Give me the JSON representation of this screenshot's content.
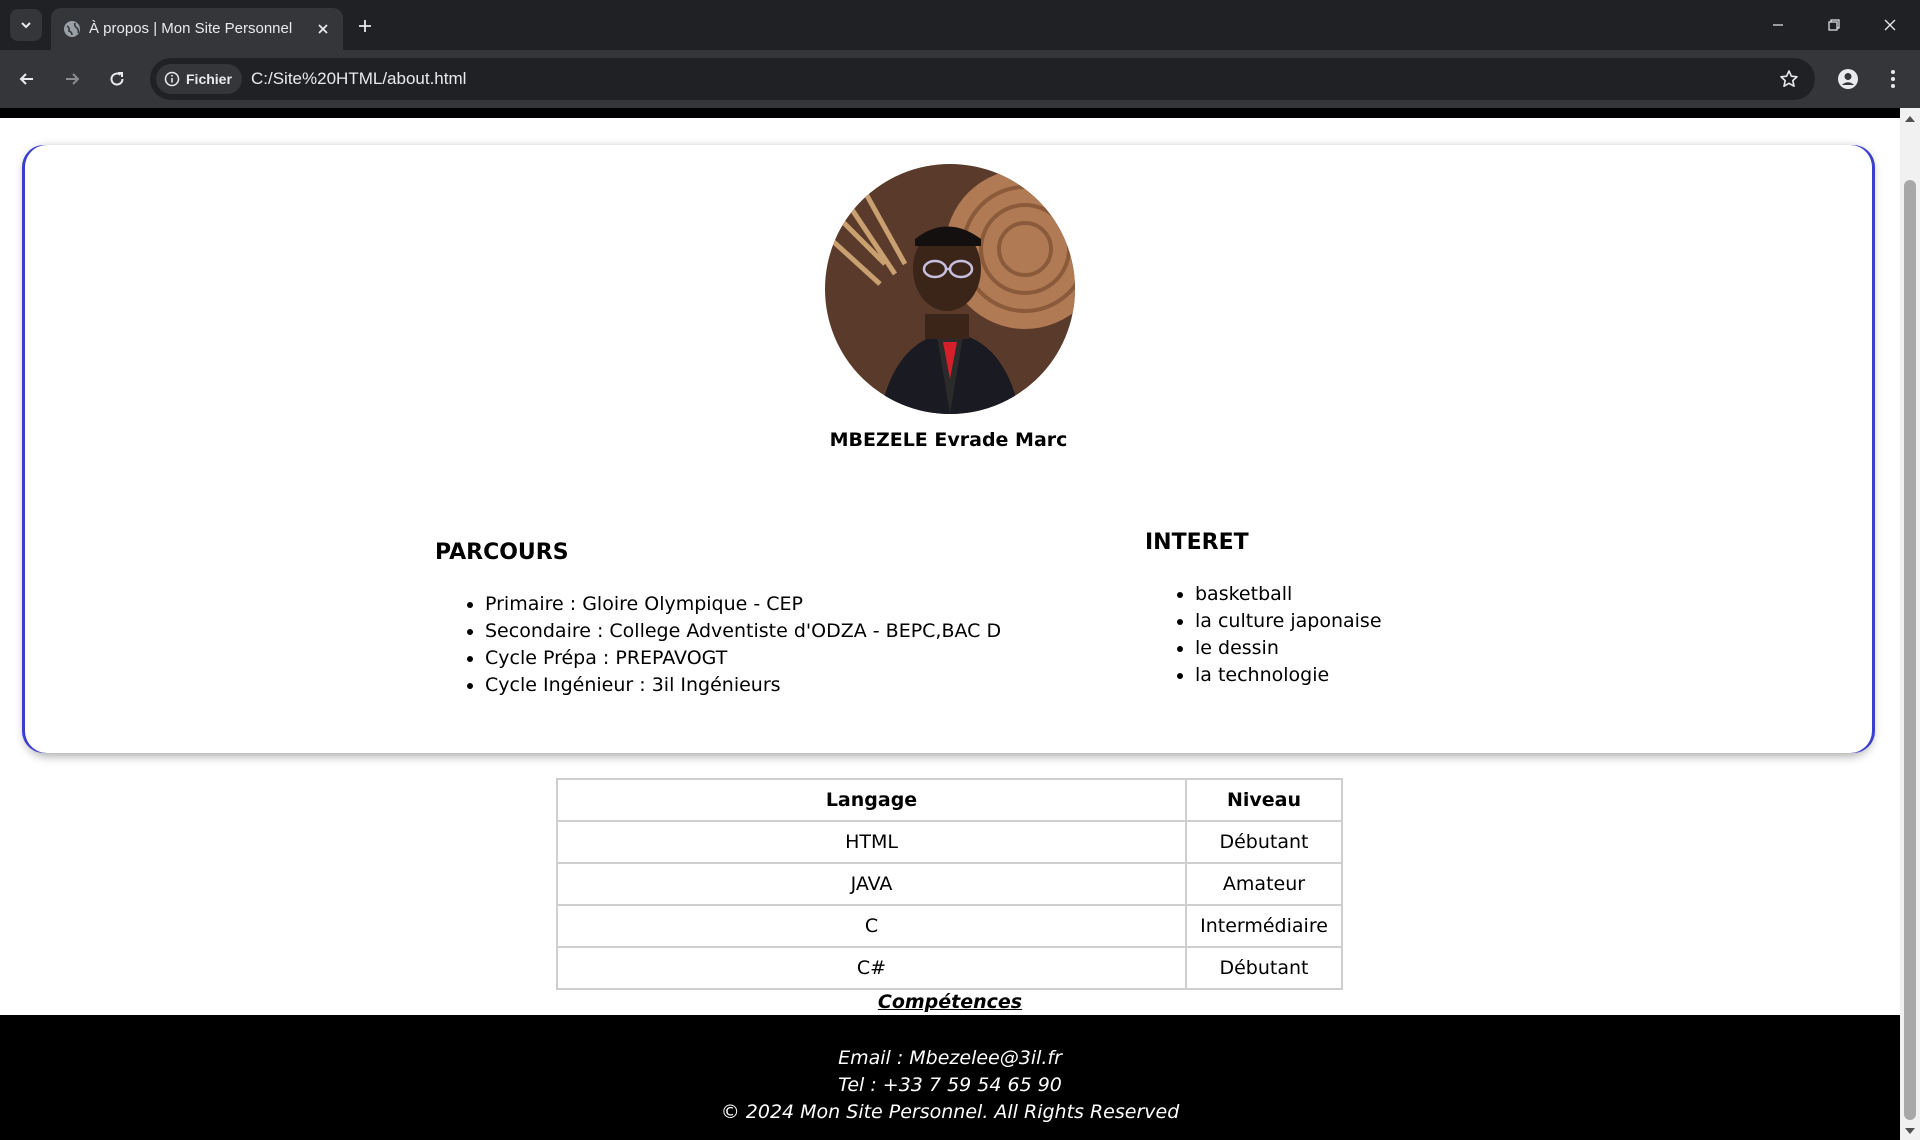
{
  "browser": {
    "tab_title": "À propos | Mon Site Personnel",
    "site_chip": "Fichier",
    "url": "C:/Site%20HTML/about.html"
  },
  "profile": {
    "name": "MBEZELE Evrade Marc"
  },
  "parcours": {
    "title": "PARCOURS",
    "items": [
      "Primaire : Gloire Olympique - CEP",
      "Secondaire : College Adventiste d'ODZA - BEPC,BAC D",
      "Cycle Prépa : PREPAVOGT",
      "Cycle Ingénieur : 3il Ingénieurs"
    ]
  },
  "interet": {
    "title": "INTERET",
    "items": [
      "basketball",
      "la culture japonaise",
      "le dessin",
      "la technologie"
    ]
  },
  "skills": {
    "headers": [
      "Langage",
      "Niveau"
    ],
    "rows": [
      [
        "HTML",
        "Débutant"
      ],
      [
        "JAVA",
        "Amateur"
      ],
      [
        "C",
        "Intermédiaire"
      ],
      [
        "C#",
        "Débutant"
      ]
    ],
    "caption": "Compétences"
  },
  "footer": {
    "email": "Email : Mbezelee@3il.fr",
    "tel": "Tel : +33 7 59 54 65 90",
    "copyright": "© 2024 Mon Site Personnel. All Rights Reserved"
  },
  "colors": {
    "card_border_accent": "#3b3fcf",
    "chrome_dark": "#202124",
    "chrome_toolbar": "#35363a",
    "footer_bg": "#000000"
  }
}
